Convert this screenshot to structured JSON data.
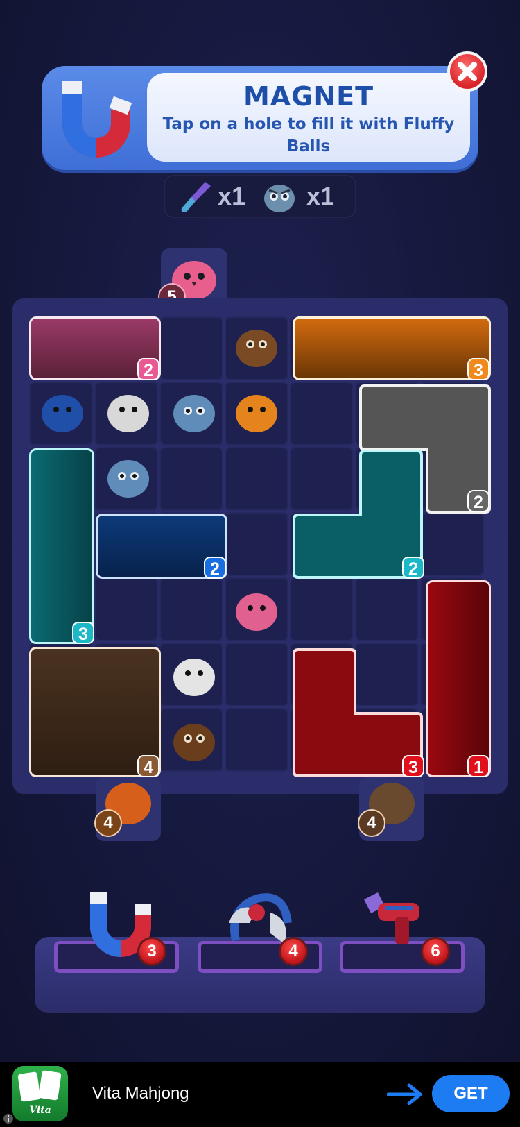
{
  "tooltip": {
    "title": "MAGNET",
    "description": "Tap on a hole to fill it with Fluffy Balls",
    "close_icon": "close-icon"
  },
  "inventory": {
    "items": [
      {
        "icon": "brush-icon",
        "count": "x1"
      },
      {
        "icon": "owl-icon",
        "count": "x1"
      }
    ]
  },
  "board": {
    "rows": 7,
    "cols": 7,
    "blocks": [
      {
        "color": "pink",
        "number": "2"
      },
      {
        "color": "orange",
        "number": "3"
      },
      {
        "color": "gray",
        "number": "2"
      },
      {
        "color": "teal",
        "number": "3"
      },
      {
        "color": "blue",
        "number": "2"
      },
      {
        "color": "teal",
        "number": "2"
      },
      {
        "color": "red",
        "number": "1"
      },
      {
        "color": "brown",
        "number": "4"
      },
      {
        "color": "red",
        "number": "3"
      }
    ],
    "gates": [
      {
        "label": "top gate",
        "count": "5",
        "color": "pink"
      },
      {
        "label": "bottom-left gate",
        "count": "4",
        "color": "orange"
      },
      {
        "label": "bottom-right gate",
        "count": "4",
        "color": "brown"
      }
    ]
  },
  "boosters": [
    {
      "name": "magnet",
      "count": "3"
    },
    {
      "name": "grabber",
      "count": "4"
    },
    {
      "name": "blaster",
      "count": "6"
    }
  ],
  "ad": {
    "app_name": "Vita Mahjong",
    "icon_caption": "Vita",
    "cta": "GET"
  }
}
